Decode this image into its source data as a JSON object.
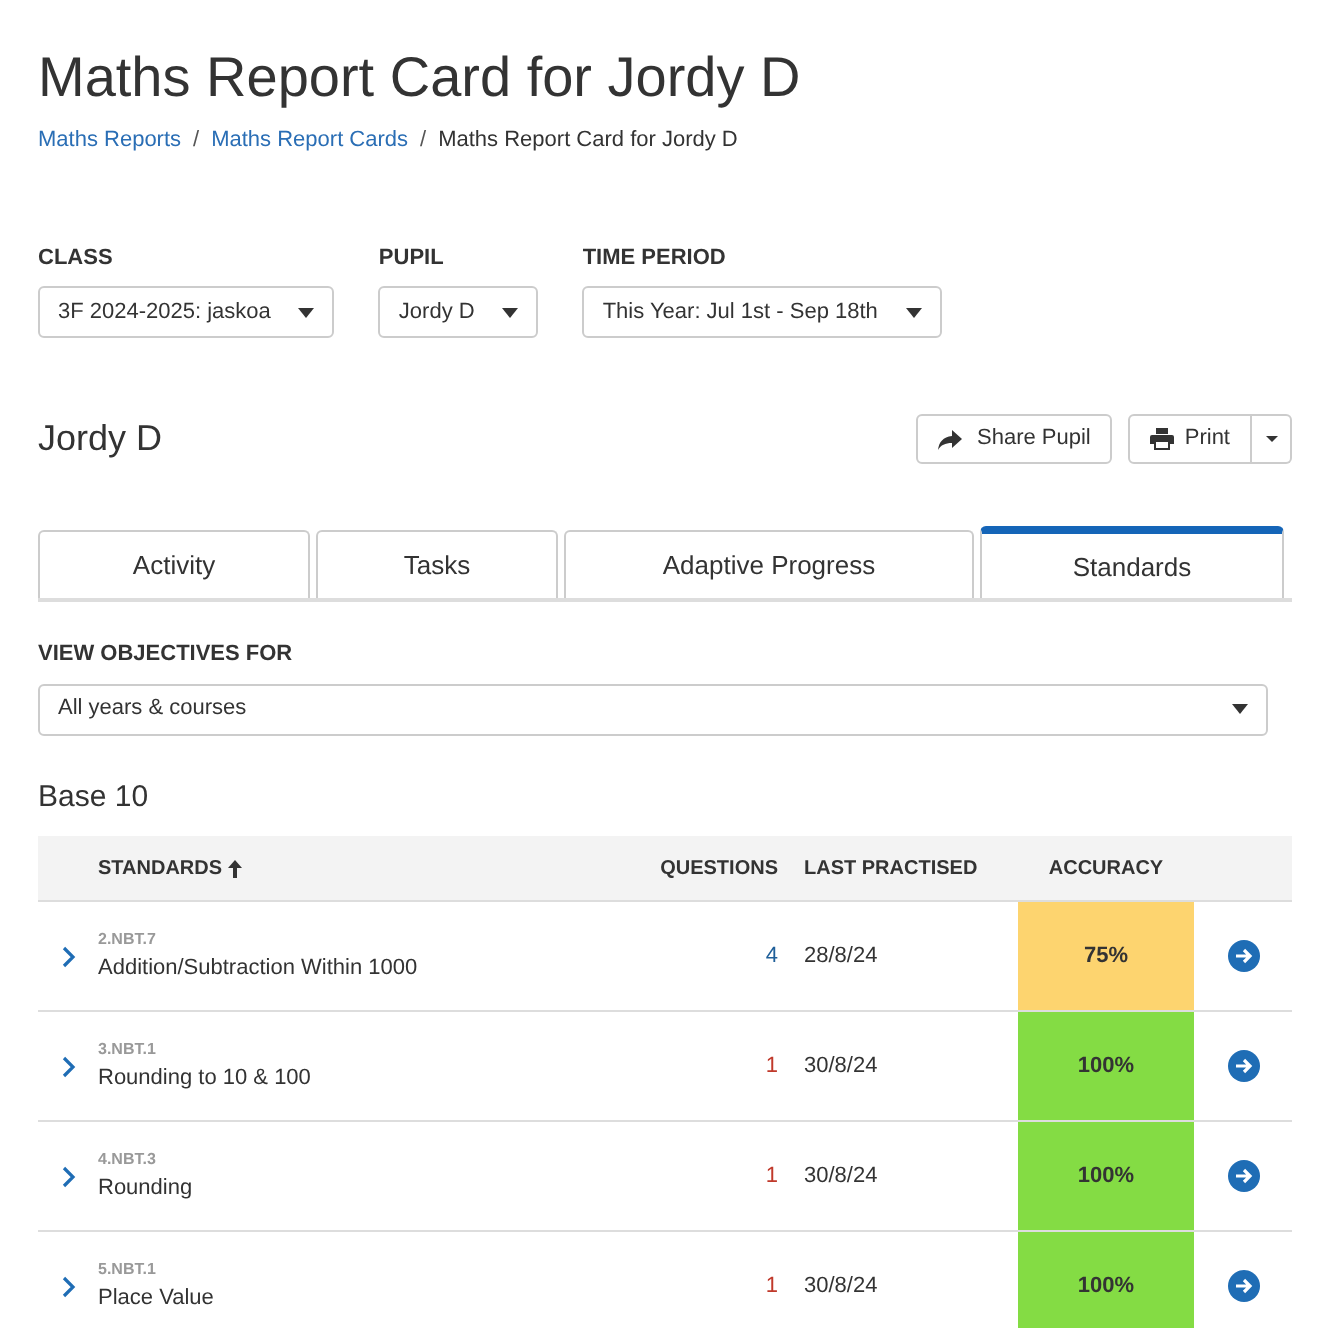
{
  "title": "Maths Report Card for Jordy D",
  "breadcrumb_separators": [
    "/",
    "/"
  ],
  "breadcrumbs": [
    {
      "label": "Maths Reports",
      "kind": "link"
    },
    {
      "label": "Maths Report Cards",
      "kind": "link"
    },
    {
      "label": "Maths Report Card for Jordy D",
      "kind": "current"
    }
  ],
  "filters": [
    {
      "label": "CLASS",
      "value": "3F 2024-2025: jaskoa"
    },
    {
      "label": "PUPIL",
      "value": "Jordy D"
    },
    {
      "label": "TIME PERIOD",
      "value": "This Year: Jul 1st - Sep 18th"
    }
  ],
  "pupil_name": "Jordy D",
  "actions": {
    "share": "Share Pupil",
    "print": "Print"
  },
  "tabs": [
    {
      "label": "Activity",
      "selected": false
    },
    {
      "label": "Tasks",
      "selected": false
    },
    {
      "label": "Adaptive Progress",
      "selected": false
    },
    {
      "label": "Standards",
      "selected": true
    }
  ],
  "objectives": {
    "label": "VIEW OBJECTIVES FOR",
    "value": "All years & courses"
  },
  "section_title": "Base 10",
  "table": {
    "columns": [
      "STANDARDS",
      "QUESTIONS",
      "LAST PRACTISED",
      "ACCURACY"
    ],
    "rows": [
      {
        "code": "2.NBT.7",
        "name": "Addition/Subtraction Within 1000",
        "questions": {
          "text": "4",
          "color": "#1f5f99"
        },
        "last": "28/8/24",
        "accuracy": "75%",
        "color": "#fdd46f"
      },
      {
        "code": "3.NBT.1",
        "name": "Rounding to 10 & 100",
        "questions": {
          "text": "1",
          "color": "#c0392b"
        },
        "last": "30/8/24",
        "accuracy": "100%",
        "color": "#84dc44"
      },
      {
        "code": "4.NBT.3",
        "name": "Rounding",
        "questions": {
          "text": "1",
          "color": "#c0392b"
        },
        "last": "30/8/24",
        "accuracy": "100%",
        "color": "#84dc44"
      },
      {
        "code": "5.NBT.1",
        "name": "Place Value",
        "questions": {
          "text": "1",
          "color": "#c0392b"
        },
        "last": "30/8/24",
        "accuracy": "100%",
        "color": "#84dc44"
      }
    ]
  }
}
